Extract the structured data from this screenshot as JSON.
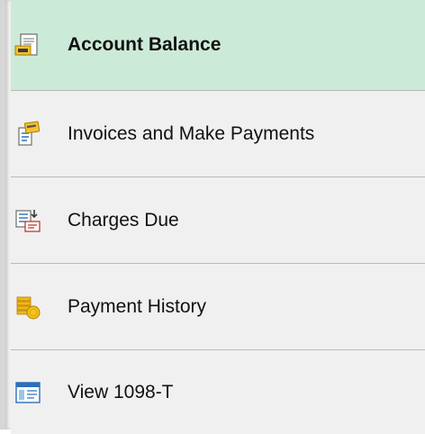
{
  "nav": {
    "items": [
      {
        "label": "Account Balance",
        "icon": "account-balance-icon",
        "selected": true
      },
      {
        "label": "Invoices and Make Payments",
        "icon": "invoice-payment-icon",
        "selected": false
      },
      {
        "label": "Charges Due",
        "icon": "charges-due-icon",
        "selected": false
      },
      {
        "label": "Payment History",
        "icon": "payment-history-icon",
        "selected": false
      },
      {
        "label": "View 1098-T",
        "icon": "tax-form-icon",
        "selected": false
      }
    ]
  },
  "colors": {
    "selected_background": "#ccead8",
    "item_background": "#f0f0f0",
    "divider": "#b9b9b9",
    "text": "#111111"
  }
}
